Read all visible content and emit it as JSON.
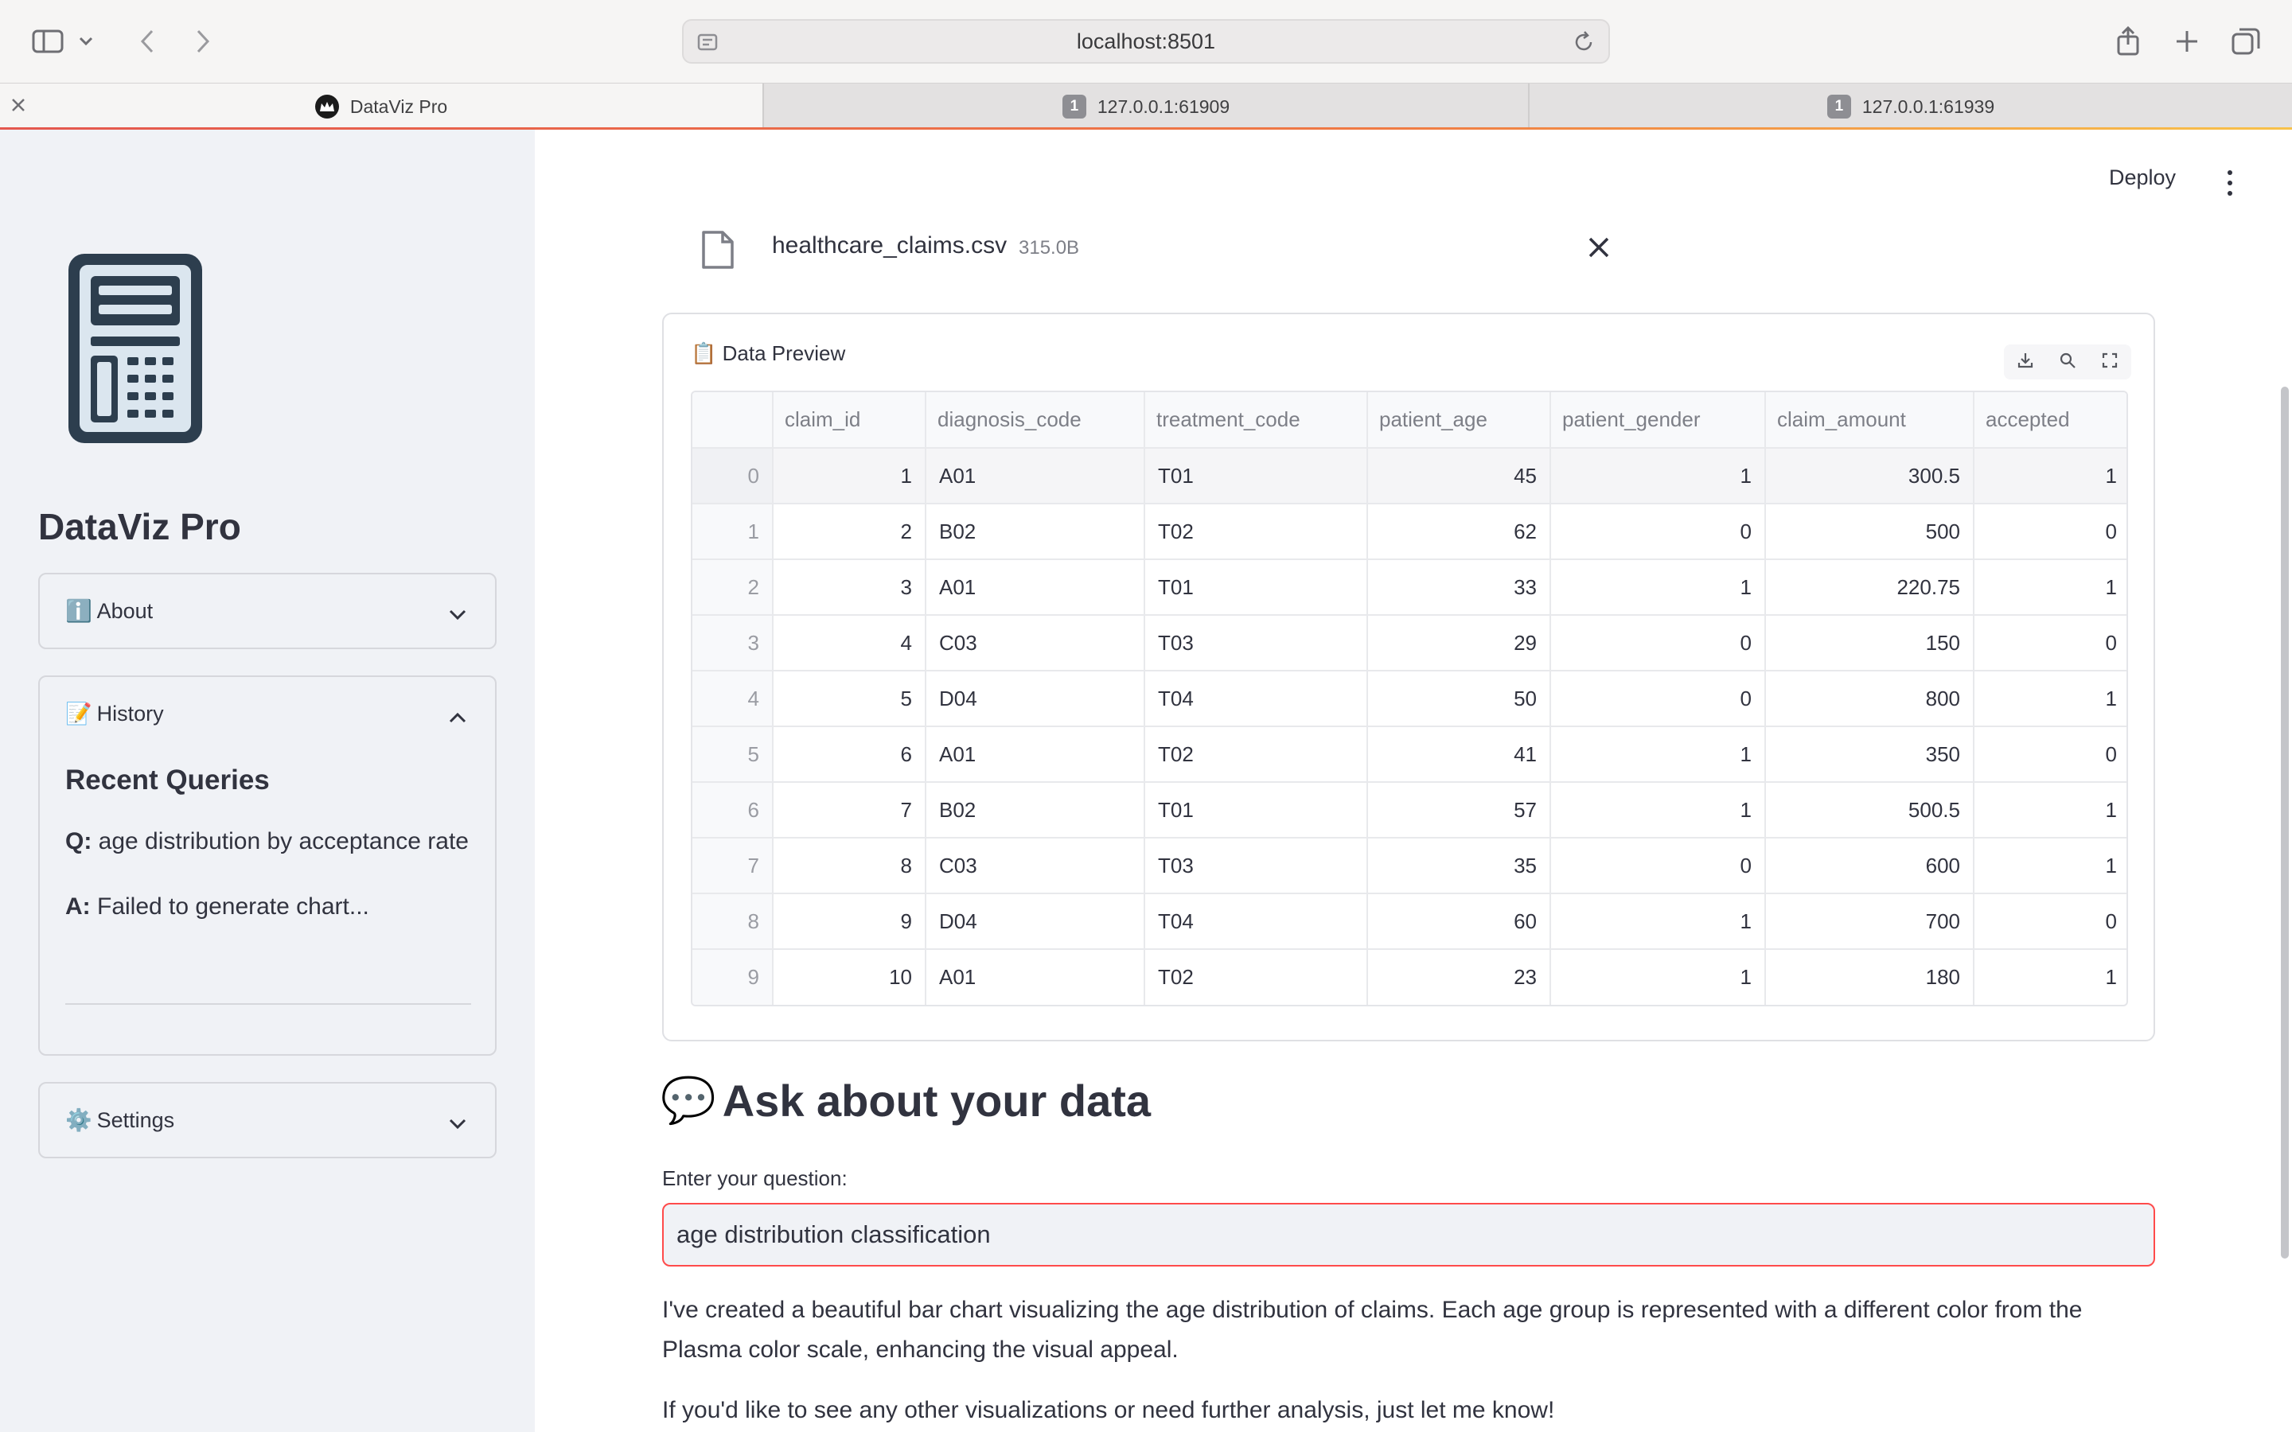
{
  "browser": {
    "url": "localhost:8501",
    "tabs": [
      {
        "title": "DataViz Pro",
        "active": true
      },
      {
        "title": "127.0.0.1:61909",
        "badge": "1",
        "active": false
      },
      {
        "title": "127.0.0.1:61939",
        "badge": "1",
        "active": false
      }
    ]
  },
  "sidebar": {
    "logo_icon": "calculator-icon",
    "app_title": "DataViz Pro",
    "about": {
      "emoji": "ℹ️",
      "label": "About"
    },
    "history": {
      "emoji": "📝",
      "label": "History",
      "heading": "Recent Queries",
      "q_prefix": "Q:",
      "q_text": "age distribution by acceptance rate",
      "a_prefix": "A:",
      "a_text": "Failed to generate chart..."
    },
    "settings": {
      "emoji": "⚙️",
      "label": "Settings"
    }
  },
  "header": {
    "deploy_label": "Deploy"
  },
  "file": {
    "name": "healthcare_claims.csv",
    "size": "315.0B"
  },
  "preview": {
    "emoji": "📋",
    "title": "Data Preview",
    "columns": [
      "",
      "claim_id",
      "diagnosis_code",
      "treatment_code",
      "patient_age",
      "patient_gender",
      "claim_amount",
      "accepted"
    ],
    "rows": [
      [
        "0",
        "1",
        "A01",
        "T01",
        "45",
        "1",
        "300.5",
        "1"
      ],
      [
        "1",
        "2",
        "B02",
        "T02",
        "62",
        "0",
        "500",
        "0"
      ],
      [
        "2",
        "3",
        "A01",
        "T01",
        "33",
        "1",
        "220.75",
        "1"
      ],
      [
        "3",
        "4",
        "C03",
        "T03",
        "29",
        "0",
        "150",
        "0"
      ],
      [
        "4",
        "5",
        "D04",
        "T04",
        "50",
        "0",
        "800",
        "1"
      ],
      [
        "5",
        "6",
        "A01",
        "T02",
        "41",
        "1",
        "350",
        "0"
      ],
      [
        "6",
        "7",
        "B02",
        "T01",
        "57",
        "1",
        "500.5",
        "1"
      ],
      [
        "7",
        "8",
        "C03",
        "T03",
        "35",
        "0",
        "600",
        "1"
      ],
      [
        "8",
        "9",
        "D04",
        "T04",
        "60",
        "1",
        "700",
        "0"
      ],
      [
        "9",
        "10",
        "A01",
        "T02",
        "23",
        "1",
        "180",
        "1"
      ]
    ]
  },
  "ask": {
    "emoji": "💬",
    "title": "Ask about your data",
    "input_label": "Enter your question:",
    "input_value": "age distribution classification",
    "answer": "I've created a beautiful bar chart visualizing the age distribution of claims. Each age group is represented with a different color from the Plasma color scale, enhancing the visual appeal.",
    "followup": "If you'd like to see any other visualizations or need further analysis, just let me know!"
  },
  "colors": {
    "accent": "#ff4b4b",
    "sidebar_bg": "#f0f2f6",
    "text": "#31333f"
  }
}
